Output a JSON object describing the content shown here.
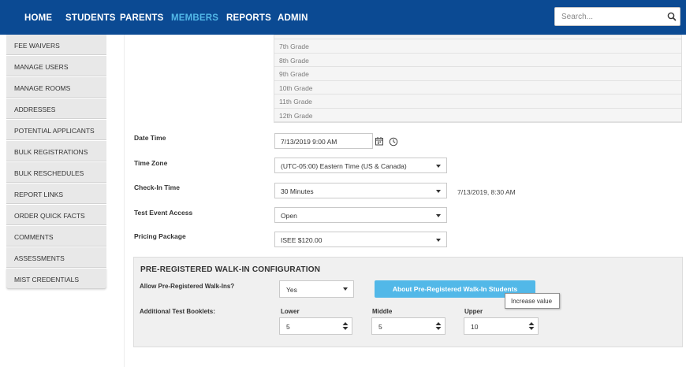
{
  "nav": {
    "items": [
      {
        "label": "HOME"
      },
      {
        "label": "STUDENTS"
      },
      {
        "label": "PARENTS"
      },
      {
        "label": "MEMBERS"
      },
      {
        "label": "REPORTS"
      },
      {
        "label": "ADMIN"
      }
    ],
    "active": "MEMBERS",
    "search_placeholder": "Search...",
    "search_icon": "magnifier-icon",
    "colors": {
      "bar": "#0b4a93",
      "active": "#52b8e8"
    }
  },
  "sidebar": {
    "items": [
      {
        "label": "FEE WAIVERS"
      },
      {
        "label": "MANAGE USERS"
      },
      {
        "label": "MANAGE ROOMS"
      },
      {
        "label": "ADDRESSES"
      },
      {
        "label": "POTENTIAL APPLICANTS"
      },
      {
        "label": "BULK REGISTRATIONS"
      },
      {
        "label": "BULK RESCHEDULES"
      },
      {
        "label": "REPORT LINKS"
      },
      {
        "label": "ORDER QUICK FACTS"
      },
      {
        "label": "COMMENTS"
      },
      {
        "label": "ASSESSMENTS"
      },
      {
        "label": "MIST CREDENTIALS"
      }
    ]
  },
  "grades": {
    "items": [
      "7th Grade",
      "8th Grade",
      "9th Grade",
      "10th Grade",
      "11th Grade",
      "12th Grade"
    ]
  },
  "form": {
    "date_time": {
      "label": "Date Time",
      "value": "7/13/2019 9:00 AM",
      "icons": [
        "calendar-icon",
        "clock-icon"
      ]
    },
    "time_zone": {
      "label": "Time Zone",
      "value": "(UTC-05:00) Eastern Time (US & Canada)"
    },
    "check_in": {
      "label": "Check-In Time",
      "value": "30 Minutes",
      "note": "7/13/2019, 8:30 AM"
    },
    "access": {
      "label": "Test Event Access",
      "value": "Open"
    },
    "pricing": {
      "label": "Pricing Package",
      "value": "ISEE $120.00"
    }
  },
  "walkin": {
    "title": "PRE-REGISTERED WALK-IN CONFIGURATION",
    "allow_label": "Allow Pre-Registered Walk-Ins?",
    "allow_value": "Yes",
    "about_button": "About Pre-Registered Walk-In Students",
    "booklets_label": "Additional Test Booklets:",
    "lower_label": "Lower",
    "lower_value": "5",
    "middle_label": "Middle",
    "middle_value": "5",
    "upper_label": "Upper",
    "upper_value": "10",
    "tooltip": "Increase value"
  }
}
